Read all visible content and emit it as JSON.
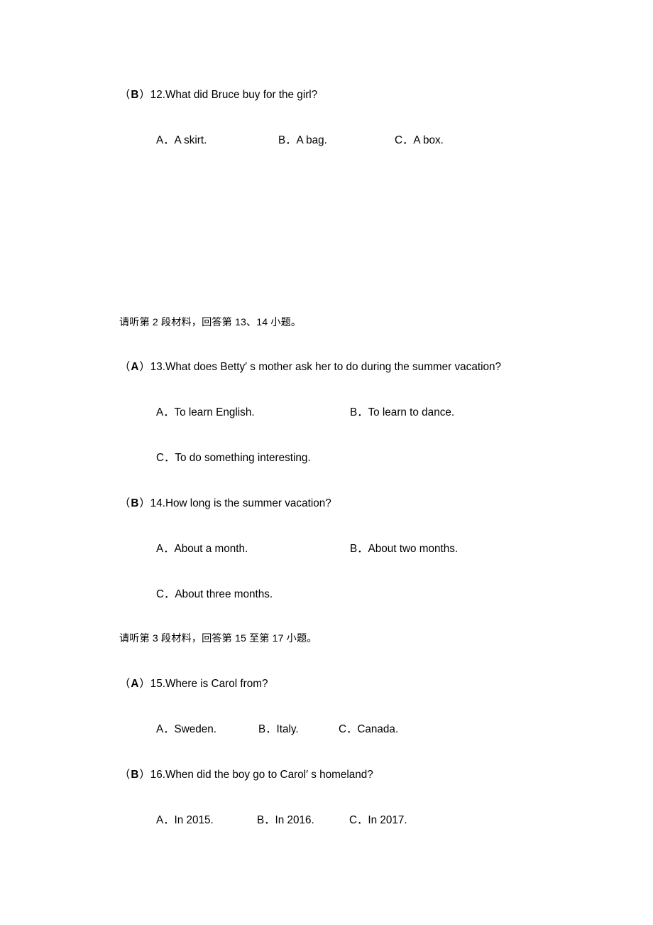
{
  "document": {
    "type": "listening-comprehension-worksheet",
    "language": "zh-CN / en",
    "background_color": "#ffffff",
    "text_color": "#000000"
  },
  "questions": [
    {
      "id": "q12",
      "marker_open": "（",
      "answer": "B",
      "marker_close": "）",
      "number": "12.",
      "stem": "What did Bruce buy for the girl?",
      "options": [
        {
          "label": "A．",
          "text": "A skirt."
        },
        {
          "label": "B．",
          "text": "A bag."
        },
        {
          "label": "C．",
          "text": "A box."
        }
      ]
    },
    {
      "id": "q13",
      "marker_open": "（",
      "answer": "A",
      "marker_close": "）",
      "number": "13.",
      "stem": "What does Betty′ s mother ask her to do during the summer vacation?",
      "options": [
        {
          "label": "A．",
          "text": "To learn English."
        },
        {
          "label": "B．",
          "text": "To learn to dance."
        },
        {
          "label": "C．",
          "text": "To do something interesting."
        }
      ]
    },
    {
      "id": "q14",
      "marker_open": "（",
      "answer": "B",
      "marker_close": "）",
      "number": "14.",
      "stem": "How long is the summer vacation?",
      "options": [
        {
          "label": "A．",
          "text": "About a month."
        },
        {
          "label": "B．",
          "text": "About two months."
        },
        {
          "label": "C．",
          "text": "About three months."
        }
      ]
    },
    {
      "id": "q15",
      "marker_open": "（",
      "answer": "A",
      "marker_close": "）",
      "number": "15.",
      "stem": "Where is Carol from?",
      "options": [
        {
          "label": "A．",
          "text": "Sweden."
        },
        {
          "label": "B．",
          "text": "Italy."
        },
        {
          "label": "C．",
          "text": "Canada."
        }
      ]
    },
    {
      "id": "q16",
      "marker_open": "（",
      "answer": "B",
      "marker_close": "）",
      "number": "16.",
      "stem": "When did the boy go to Carol′ s homeland?",
      "options": [
        {
          "label": "A．",
          "text": "In 2015."
        },
        {
          "label": "B．",
          "text": "In 2016."
        },
        {
          "label": "C．",
          "text": "In 2017."
        }
      ]
    }
  ],
  "sections": [
    {
      "id": "section2",
      "text": "请听第 2 段材料，回答第 13、14 小题。"
    },
    {
      "id": "section3",
      "text": "请听第 3 段材料，回答第 15 至第 17 小题。"
    }
  ]
}
